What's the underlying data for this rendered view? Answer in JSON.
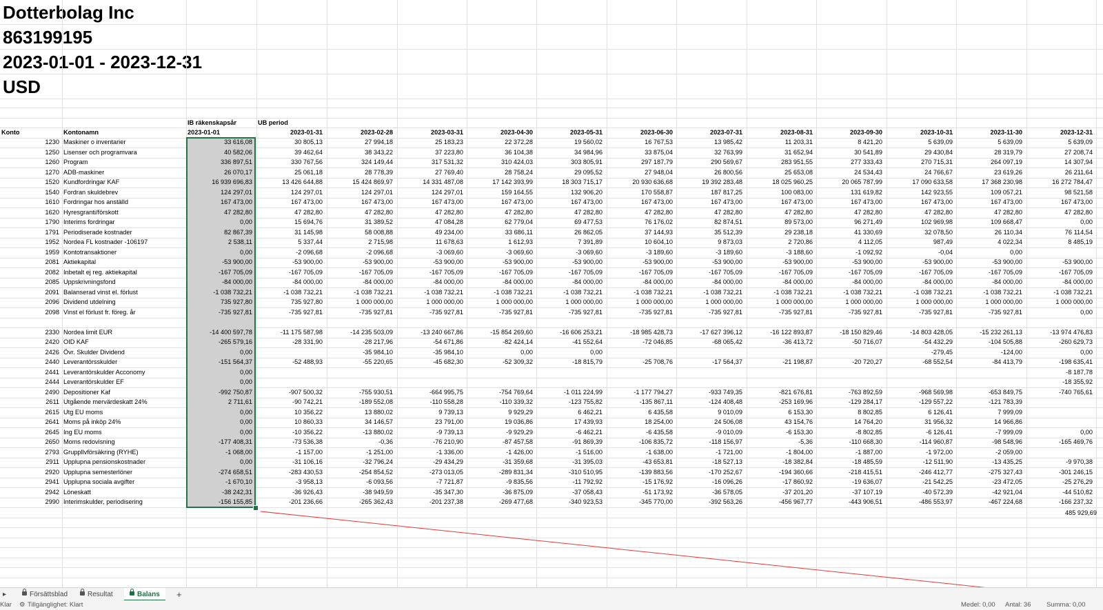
{
  "header": {
    "company": "Dotterbolag Inc",
    "org_no": "863199195",
    "period": "2023-01-01 - 2023-12-31",
    "currency": "USD"
  },
  "table": {
    "group_labels": [
      "IB räkenskapsår",
      "UB period"
    ],
    "col_konto": "Konto",
    "col_kontonamn": "Kontonamn",
    "dates": [
      "2023-01-01",
      "2023-01-31",
      "2023-02-28",
      "2023-03-31",
      "2023-04-30",
      "2023-05-31",
      "2023-06-30",
      "2023-07-31",
      "2023-08-31",
      "2023-09-30",
      "2023-10-31",
      "2023-11-30",
      "2023-12-31"
    ],
    "rows": [
      {
        "konto": "1230",
        "name": "Maskiner o inventarier",
        "values": [
          "33 616,08",
          "30 805,13",
          "27 994,18",
          "25 183,23",
          "22 372,28",
          "19 560,02",
          "16 767,53",
          "13 985,42",
          "11 203,31",
          "8 421,20",
          "5 639,09",
          "5 639,09",
          "5 639,09"
        ]
      },
      {
        "konto": "1250",
        "name": "Lisenser och programvara",
        "values": [
          "40 582,06",
          "39 462,64",
          "38 343,22",
          "37 223,80",
          "36 104,38",
          "34 984,96",
          "33 875,04",
          "32 763,99",
          "31 652,94",
          "30 541,89",
          "29 430,84",
          "28 319,79",
          "27 208,74"
        ]
      },
      {
        "konto": "1260",
        "name": "Program",
        "values": [
          "336 897,51",
          "330 767,56",
          "324 149,44",
          "317 531,32",
          "310 424,03",
          "303 805,91",
          "297 187,79",
          "290 569,67",
          "283 951,55",
          "277 333,43",
          "270 715,31",
          "264 097,19",
          "14 307,94"
        ]
      },
      {
        "konto": "1270",
        "name": "ADB-maskiner",
        "values": [
          "26 070,17",
          "25 061,18",
          "28 778,39",
          "27 769,40",
          "28 758,24",
          "29 095,52",
          "27 948,04",
          "26 800,56",
          "25 653,08",
          "24 534,43",
          "24 766,67",
          "23 619,26",
          "26 211,64"
        ]
      },
      {
        "konto": "1520",
        "name": "Kundfordringar KAF",
        "values": [
          "16 939 696,83",
          "13 426 644,88",
          "15 424 869,97",
          "14 331 487,08",
          "17 142 393,99",
          "18 303 715,17",
          "20 930 636,68",
          "19 392 283,48",
          "18 025 960,25",
          "20 065 787,99",
          "17 090 633,58",
          "17 368 230,98",
          "16 272 784,47"
        ]
      },
      {
        "konto": "1540",
        "name": "Fordran skuldebrev",
        "values": [
          "124 297,01",
          "124 297,01",
          "124 297,01",
          "124 297,01",
          "159 164,55",
          "132 906,20",
          "170 558,87",
          "187 817,25",
          "100 083,00",
          "131 619,82",
          "142 923,55",
          "109 057,21",
          "98 521,58"
        ]
      },
      {
        "konto": "1610",
        "name": "Fordringar hos anställd",
        "values": [
          "167 473,00",
          "167 473,00",
          "167 473,00",
          "167 473,00",
          "167 473,00",
          "167 473,00",
          "167 473,00",
          "167 473,00",
          "167 473,00",
          "167 473,00",
          "167 473,00",
          "167 473,00",
          "167 473,00"
        ]
      },
      {
        "konto": "1620",
        "name": "Hyresgranti/förskott",
        "values": [
          "47 282,80",
          "47 282,80",
          "47 282,80",
          "47 282,80",
          "47 282,80",
          "47 282,80",
          "47 282,80",
          "47 282,80",
          "47 282,80",
          "47 282,80",
          "47 282,80",
          "47 282,80",
          "47 282,80"
        ]
      },
      {
        "konto": "1790",
        "name": "Interims fordringar",
        "values": [
          "0,00",
          "15 694,76",
          "31 389,52",
          "47 084,28",
          "62 779,04",
          "69 477,53",
          "76 176,02",
          "82 874,51",
          "89 573,00",
          "96 271,49",
          "102 969,98",
          "109 668,47",
          "0,00"
        ]
      },
      {
        "konto": "1791",
        "name": "Periodiserade kostnader",
        "values": [
          "82 867,39",
          "31 145,98",
          "58 008,88",
          "49 234,00",
          "33 686,11",
          "26 862,05",
          "37 144,93",
          "35 512,39",
          "29 238,18",
          "41 330,69",
          "32 078,50",
          "26 110,34",
          "76 114,54"
        ]
      },
      {
        "konto": "1952",
        "name": "Nordea FL kostnader -106197",
        "values": [
          "2 538,11",
          "5 337,44",
          "2 715,98",
          "11 678,63",
          "1 612,93",
          "7 391,89",
          "10 604,10",
          "9 873,03",
          "2 720,86",
          "4 112,05",
          "987,49",
          "4 022,34",
          "8 485,19"
        ]
      },
      {
        "konto": "1959",
        "name": "Kontotransaktioner",
        "values": [
          "0,00",
          "-2 096,68",
          "-2 096,68",
          "-3 069,60",
          "-3 069,60",
          "-3 069,60",
          "-3 189,60",
          "-3 189,60",
          "-3 188,60",
          "-1 092,92",
          "-0,04",
          "0,00",
          ""
        ]
      },
      {
        "konto": "2081",
        "name": "Aktiekapital",
        "values": [
          "-53 900,00",
          "-53 900,00",
          "-53 900,00",
          "-53 900,00",
          "-53 900,00",
          "-53 900,00",
          "-53 900,00",
          "-53 900,00",
          "-53 900,00",
          "-53 900,00",
          "-53 900,00",
          "-53 900,00",
          "-53 900,00"
        ]
      },
      {
        "konto": "2082",
        "name": "Inbetalt ej reg. aktiekapital",
        "values": [
          "-167 705,09",
          "-167 705,09",
          "-167 705,09",
          "-167 705,09",
          "-167 705,09",
          "-167 705,09",
          "-167 705,09",
          "-167 705,09",
          "-167 705,09",
          "-167 705,09",
          "-167 705,09",
          "-167 705,09",
          "-167 705,09"
        ]
      },
      {
        "konto": "2085",
        "name": "Uppskrivningsfond",
        "values": [
          "-84 000,00",
          "-84 000,00",
          "-84 000,00",
          "-84 000,00",
          "-84 000,00",
          "-84 000,00",
          "-84 000,00",
          "-84 000,00",
          "-84 000,00",
          "-84 000,00",
          "-84 000,00",
          "-84 000,00",
          "-84 000,00"
        ]
      },
      {
        "konto": "2091",
        "name": "Balanserad vinst el. förlust",
        "values": [
          "-1 038 732,21",
          "-1 038 732,21",
          "-1 038 732,21",
          "-1 038 732,21",
          "-1 038 732,21",
          "-1 038 732,21",
          "-1 038 732,21",
          "-1 038 732,21",
          "-1 038 732,21",
          "-1 038 732,21",
          "-1 038 732,21",
          "-1 038 732,21",
          "-1 038 732,21"
        ]
      },
      {
        "konto": "2096",
        "name": "Dividend utdelning",
        "values": [
          "735 927,80",
          "735 927,80",
          "1 000 000,00",
          "1 000 000,00",
          "1 000 000,00",
          "1 000 000,00",
          "1 000 000,00",
          "1 000 000,00",
          "1 000 000,00",
          "1 000 000,00",
          "1 000 000,00",
          "1 000 000,00",
          "1 000 000,00"
        ]
      },
      {
        "konto": "2098",
        "name": "Vinst el förlust fr. föreg. år",
        "values": [
          "-735 927,81",
          "-735 927,81",
          "-735 927,81",
          "-735 927,81",
          "-735 927,81",
          "-735 927,81",
          "-735 927,81",
          "-735 927,81",
          "-735 927,81",
          "-735 927,81",
          "-735 927,81",
          "-735 927,81",
          "0,00"
        ]
      },
      {
        "konto": "",
        "name": "",
        "values": [
          "",
          "",
          "",
          "",
          "",
          "",
          "",
          "",
          "",
          "",
          "",
          "",
          ""
        ]
      },
      {
        "konto": "2330",
        "name": "Nordea limit EUR",
        "values": [
          "-14 400 597,78",
          "-11 175 587,98",
          "-14 235 503,09",
          "-13 240 667,86",
          "-15 854 269,60",
          "-16 606 253,21",
          "-18 985 428,73",
          "-17 627 396,12",
          "-16 122 893,87",
          "-18 150 829,46",
          "-14 803 428,05",
          "-15 232 261,13",
          "-13 974 476,83"
        ]
      },
      {
        "konto": "2420",
        "name": "OID KAF",
        "values": [
          "-265 579,16",
          "-28 331,90",
          "-28 217,96",
          "-54 671,86",
          "-82 424,14",
          "-41 552,64",
          "-72 046,85",
          "-68 065,42",
          "-36 413,72",
          "-50 716,07",
          "-54 432,29",
          "-104 505,88",
          "-260 629,73"
        ]
      },
      {
        "konto": "2426",
        "name": "Övr. Skulder Dividend",
        "values": [
          "0,00",
          "",
          "-35 984,10",
          "-35 984,10",
          "0,00",
          "0,00",
          "",
          "",
          "",
          "",
          "-279,45",
          "-124,00",
          "0,00"
        ]
      },
      {
        "konto": "2440",
        "name": "Leverantörsskulder",
        "values": [
          "-151 564,37",
          "-52 488,93",
          "-55 220,65",
          "-45 682,30",
          "-52 309,32",
          "-18 815,79",
          "-25 708,76",
          "-17 564,37",
          "-21 198,87",
          "-20 720,27",
          "-68 552,54",
          "-84 413,79",
          "-198 635,41"
        ]
      },
      {
        "konto": "2441",
        "name": "Leverantörskulder Acconomy",
        "values": [
          "0,00",
          "",
          "",
          "",
          "",
          "",
          "",
          "",
          "",
          "",
          "",
          "",
          "-8 187,78"
        ]
      },
      {
        "konto": "2444",
        "name": "Leverantörskulder EF",
        "values": [
          "0,00",
          "",
          "",
          "",
          "",
          "",
          "",
          "",
          "",
          "",
          "",
          "",
          "-18 355,92"
        ]
      },
      {
        "konto": "2490",
        "name": "Depositioner Kaf",
        "values": [
          "-992 750,87",
          "-907 500,32",
          "-755 930,51",
          "-664 995,75",
          "-754 769,64",
          "-1 011 224,99",
          "-1 177 794,27",
          "-933 749,35",
          "-821 676,81",
          "-763 892,59",
          "-968 569,98",
          "-653 849,75",
          "-740 765,61"
        ]
      },
      {
        "konto": "2611",
        "name": "Utgående mervärdeskatt 24%",
        "values": [
          "2 711,61",
          "-90 742,21",
          "-189 552,08",
          "-110 558,28",
          "-110 339,32",
          "-123 755,82",
          "-135 867,11",
          "-124 408,48",
          "-253 169,96",
          "-129 284,17",
          "-129 557,22",
          "-121 783,39",
          ""
        ]
      },
      {
        "konto": "2615",
        "name": "Utg EU moms",
        "values": [
          "0,00",
          "10 356,22",
          "13 880,02",
          "9 739,13",
          "9 929,29",
          "6 462,21",
          "6 435,58",
          "9 010,09",
          "6 153,30",
          "8 802,85",
          "6 126,41",
          "7 999,09",
          ""
        ]
      },
      {
        "konto": "2641",
        "name": "Moms på inköp 24%",
        "values": [
          "0,00",
          "10 860,33",
          "34 146,57",
          "23 791,00",
          "19 036,86",
          "17 439,93",
          "18 254,00",
          "24 506,08",
          "43 154,76",
          "14 764,20",
          "31 956,32",
          "14 966,86",
          ""
        ]
      },
      {
        "konto": "2645",
        "name": "Ing EU moms",
        "values": [
          "0,00",
          "-10 356,22",
          "-13 880,02",
          "-9 739,13",
          "-9 929,29",
          "-6 462,21",
          "-6 435,58",
          "-9 010,09",
          "-6 153,30",
          "-8 802,85",
          "-6 126,41",
          "-7 999,09",
          "0,00"
        ]
      },
      {
        "konto": "2650",
        "name": "Moms redovisning",
        "values": [
          "-177 408,31",
          "-73 536,38",
          "-0,36",
          "-76 210,90",
          "-87 457,58",
          "-91 869,39",
          "-106 835,72",
          "-118 156,97",
          "-5,36",
          "-110 668,30",
          "-114 960,87",
          "-98 548,96",
          "-165 469,76"
        ]
      },
      {
        "konto": "2793",
        "name": "Gruppllvförsäkring  (RYHE)",
        "values": [
          "-1 068,00",
          "-1 157,00",
          "-1 251,00",
          "-1 336,00",
          "-1 426,00",
          "-1 516,00",
          "-1 638,00",
          "-1 721,00",
          "-1 804,00",
          "-1 887,00",
          "-1 972,00",
          "-2 059,00",
          ""
        ]
      },
      {
        "konto": "2911",
        "name": "Upplupna pensionskostnader",
        "values": [
          "0,00",
          "-31 106,16",
          "-32 796,24",
          "-29 434,29",
          "-31 359,68",
          "-31 395,03",
          "-43 653,81",
          "-18 527,13",
          "-18 382,84",
          "-18 485,59",
          "-12 511,90",
          "-13 435,25",
          "-9 970,38"
        ]
      },
      {
        "konto": "2920",
        "name": "Upplupna semesterlöner",
        "values": [
          "-274 658,51",
          "-283 430,53",
          "-254 854,52",
          "-273 013,05",
          "-289 831,34",
          "-310 510,95",
          "-139 883,56",
          "-170 252,67",
          "-194 360,66",
          "-218 415,51",
          "-246 412,77",
          "-275 327,43",
          "-301 246,15"
        ]
      },
      {
        "konto": "2941",
        "name": "Upplupna sociala avgifter",
        "values": [
          "-1 670,10",
          "-3 958,13",
          "-6 093,56",
          "-7 721,87",
          "-9 835,56",
          "-11 792,92",
          "-15 176,92",
          "-16 096,26",
          "-17 860,92",
          "-19 636,07",
          "-21 542,25",
          "-23 472,05",
          "-25 276,29"
        ]
      },
      {
        "konto": "2942",
        "name": "Löneskatt",
        "values": [
          "-38 242,31",
          "-36 926,43",
          "-38 949,59",
          "-35 347,30",
          "-36 875,09",
          "-37 058,43",
          "-51 173,92",
          "-36 578,05",
          "-37 201,20",
          "-37 107,19",
          "-40 572,39",
          "-42 921,04",
          "-44 510,82"
        ]
      },
      {
        "konto": "2990",
        "name": "Interimskulder, periodisering",
        "values": [
          "-156 155,85",
          "-201 236,66",
          "-265 362,43",
          "-201 237,38",
          "-269 477,68",
          "-340 923,53",
          "-345 770,00",
          "-392 563,26",
          "-456 967,77",
          "-443 906,51",
          "-486 553,97",
          "-467 224,68",
          "-166 237,32"
        ]
      }
    ],
    "extra_total": "485 929,69"
  },
  "tabs": [
    {
      "label": "Försättsblad",
      "locked": true
    },
    {
      "label": "Resultat",
      "locked": true
    },
    {
      "label": "Balans",
      "locked": true,
      "active": true
    }
  ],
  "add_sheet_label": "+",
  "status": {
    "ready": "Klar",
    "accessibility": "Tillgänglighet: Klart",
    "average": "Medel: 0,00",
    "count": "Antal: 36",
    "sum": "Summa: 0,00"
  },
  "colors": {
    "selection_border": "#217346",
    "annotation_arrow": "#e53935",
    "active_tab": "#1e7145"
  }
}
